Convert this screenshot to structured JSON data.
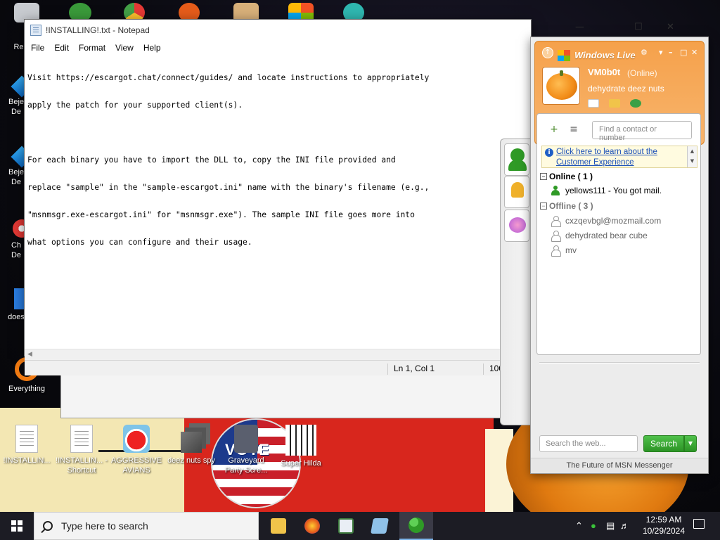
{
  "notepad": {
    "title": "!INSTALLING!.txt - Notepad",
    "menu": [
      "File",
      "Edit",
      "Format",
      "View",
      "Help"
    ],
    "lines": [
      "Visit https://escargot.chat/connect/guides/ and locate instructions to appropriately",
      "apply the patch for your supported client(s).",
      "",
      "For each binary you have to import the DLL to, copy the INI file provided and",
      "replace \"sample\" in the \"sample-escargot.ini\" name with the binary's filename (e.g.,",
      "\"msnmsgr.exe-escargot.ini\" for \"msnmsgr.exe\"). The sample INI file goes more into",
      "what options you can configure and their usage."
    ],
    "status_position": "Ln 1, Col 1",
    "status_zoom": "100"
  },
  "desktop_icons": [
    {
      "label": "Recy",
      "icon": "recycle-bin-icon"
    },
    {
      "label": "Beje De",
      "icon": "bejeweled-icon"
    },
    {
      "label": "Beje De",
      "icon": "bejeweled-icon"
    },
    {
      "label": "Ch De",
      "icon": "chrome-icon"
    },
    {
      "label": "does",
      "icon": "app-icon"
    },
    {
      "label": "Everything",
      "icon": "everything-search-icon"
    },
    {
      "label": "!INSTALLIN...",
      "icon": "text-file-icon"
    },
    {
      "label": "!INSTALLIN... - Shortcut",
      "icon": "text-file-shortcut-icon"
    },
    {
      "label": "AGGRESSIVE AVIANS",
      "icon": "angry-bird-icon"
    },
    {
      "label": "deez nuts spy",
      "icon": "app-shortcut-icon"
    },
    {
      "label": "Graveyard Party Scre...",
      "icon": "game-icon"
    },
    {
      "label": "Super Hilda",
      "icon": "pixel-game-icon"
    }
  ],
  "wallpaper": {
    "vote_text": "VOTE"
  },
  "msn": {
    "brand": "Windows Live",
    "username": "VM0b0t",
    "status": "(Online)",
    "personal_message": "dehydrate deez nuts",
    "find_placeholder": "Find a contact or number",
    "ad_text": "Click here to learn about the Customer Experience",
    "groups": [
      {
        "label": "Online ( 1 )",
        "contacts": [
          "yellows111 - You got mail."
        ]
      },
      {
        "label": "Offline ( 3 )",
        "contacts": [
          "cxzqevbgl@mozmail.com",
          "dehydrated bear cube",
          "mv"
        ]
      }
    ],
    "web_search_placeholder": "Search the web...",
    "search_button": "Search",
    "footer": "The Future of MSN Messenger"
  },
  "taskbar": {
    "search_placeholder": "Type here to search",
    "time": "12:59 AM",
    "date": "10/29/2024"
  },
  "colors": {
    "msn_header": "#f5a14b",
    "msn_search_green": "#2c9425",
    "taskbar": "#1c1c24"
  }
}
